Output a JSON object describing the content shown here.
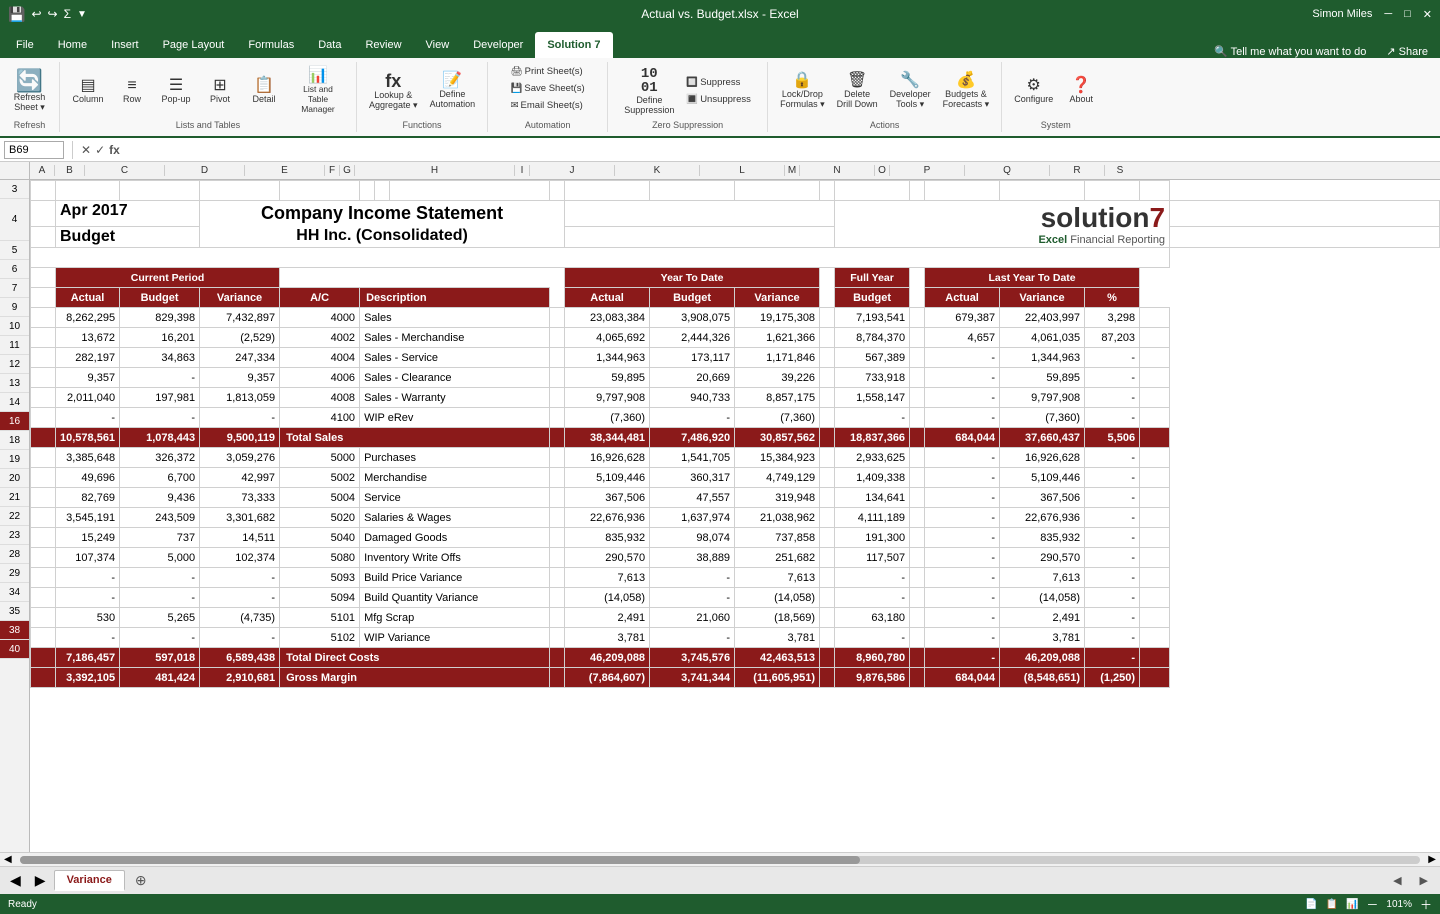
{
  "titleBar": {
    "title": "Actual vs. Budget.xlsx - Excel",
    "user": "Simon Miles"
  },
  "ribbon": {
    "tabs": [
      "File",
      "Home",
      "Insert",
      "Page Layout",
      "Formulas",
      "Data",
      "Review",
      "View",
      "Developer",
      "Solution 7"
    ],
    "activeTab": "Solution 7",
    "groups": {
      "refresh": {
        "label": "Refresh",
        "items": [
          {
            "icon": "🔄",
            "text": "Refresh\nSheet ▾"
          }
        ]
      },
      "listsAndTables": {
        "label": "Lists and Tables",
        "items": [
          {
            "icon": "▤",
            "text": "Column"
          },
          {
            "icon": "≡",
            "text": "Row"
          },
          {
            "icon": "☰",
            "text": "Pop-up"
          },
          {
            "icon": "⊞",
            "text": "Pivot"
          },
          {
            "icon": "📋",
            "text": "Detail"
          },
          {
            "icon": "📊",
            "text": "List and Table\nManager"
          }
        ]
      },
      "functions": {
        "label": "Functions",
        "items": [
          {
            "icon": "fx",
            "text": "Lookup &\nAggregate ▾"
          },
          {
            "icon": "📝",
            "text": "Define\nAutomation"
          }
        ]
      },
      "automation": {
        "label": "Automation",
        "items": [
          {
            "text": "🖨 Print Sheet(s)"
          },
          {
            "text": "💾 Save Sheet(s)"
          },
          {
            "text": "✉ Email Sheet(s)"
          }
        ]
      },
      "zeroSuppression": {
        "label": "Zero Suppression",
        "items": [
          {
            "icon": "10|01",
            "text": "Define\nSuppression"
          },
          {
            "text": "Suppress"
          },
          {
            "text": "Unsuppress"
          }
        ]
      },
      "actions": {
        "label": "Actions",
        "items": [
          {
            "icon": "🔒",
            "text": "Lock/Drop\nFormulas ▾"
          },
          {
            "icon": "🗑",
            "text": "Delete\nDrill Down"
          },
          {
            "icon": "🔧",
            "text": "Developer\nTools ▾"
          },
          {
            "icon": "💰",
            "text": "Budgets &\nForecasts ▾"
          }
        ]
      },
      "system": {
        "label": "System",
        "items": [
          {
            "icon": "⚙",
            "text": "Configure"
          },
          {
            "icon": "❓",
            "text": "About"
          }
        ]
      }
    }
  },
  "formulaBar": {
    "cellRef": "B69",
    "formula": ""
  },
  "spreadsheet": {
    "title1": "Company Income Statement",
    "title2": "HH Inc. (Consolidated)",
    "period": "Apr 2017",
    "periodType": "Budget",
    "logo": "solution7",
    "logoSub": "Excel Financial Reporting",
    "columnHeaders": [
      "B",
      "C",
      "D",
      "E",
      "F",
      "G",
      "H",
      "I",
      "J",
      "K",
      "L",
      "M",
      "N",
      "O",
      "P",
      "Q",
      "R",
      "S"
    ],
    "headers": {
      "currentPeriod": "Current Period",
      "actual": "Actual",
      "budget": "Budget",
      "variance": "Variance",
      "ac": "A/C",
      "description": "Description",
      "ytd": "Year To Date",
      "ytdActual": "Actual",
      "ytdBudget": "Budget",
      "ytdVariance": "Variance",
      "fullYear": "Full Year",
      "fullYearBudget": "Budget",
      "lastYearToDate": "Last Year To Date",
      "lytdActual": "Actual",
      "lytdVariance": "Variance",
      "pct": "%"
    },
    "rows": [
      {
        "rowNum": "9",
        "cpActual": "8,262,295",
        "cpBudget": "829,398",
        "cpVariance": "7,432,897",
        "ac": "4000",
        "desc": "Sales",
        "ytdActual": "23,083,384",
        "ytdBudget": "3,908,075",
        "ytdVariance": "19,175,308",
        "fyBudget": "7,193,541",
        "lytdActual": "679,387",
        "lytdVariance": "22,403,997",
        "pct": "3,298"
      },
      {
        "rowNum": "10",
        "cpActual": "13,672",
        "cpBudget": "16,201",
        "cpVariance": "(2,529)",
        "ac": "4002",
        "desc": "Sales - Merchandise",
        "ytdActual": "4,065,692",
        "ytdBudget": "2,444,326",
        "ytdVariance": "1,621,366",
        "fyBudget": "8,784,370",
        "lytdActual": "4,657",
        "lytdVariance": "4,061,035",
        "pct": "87,203"
      },
      {
        "rowNum": "11",
        "cpActual": "282,197",
        "cpBudget": "34,863",
        "cpVariance": "247,334",
        "ac": "4004",
        "desc": "Sales - Service",
        "ytdActual": "1,344,963",
        "ytdBudget": "173,117",
        "ytdVariance": "1,171,846",
        "fyBudget": "567,389",
        "lytdActual": "-",
        "lytdVariance": "1,344,963",
        "pct": "-"
      },
      {
        "rowNum": "12",
        "cpActual": "9,357",
        "cpBudget": "-",
        "cpVariance": "9,357",
        "ac": "4006",
        "desc": "Sales - Clearance",
        "ytdActual": "59,895",
        "ytdBudget": "20,669",
        "ytdVariance": "39,226",
        "fyBudget": "733,918",
        "lytdActual": "-",
        "lytdVariance": "59,895",
        "pct": "-"
      },
      {
        "rowNum": "13",
        "cpActual": "2,011,040",
        "cpBudget": "197,981",
        "cpVariance": "1,813,059",
        "ac": "4008",
        "desc": "Sales - Warranty",
        "ytdActual": "9,797,908",
        "ytdBudget": "940,733",
        "ytdVariance": "8,857,175",
        "fyBudget": "1,558,147",
        "lytdActual": "-",
        "lytdVariance": "9,797,908",
        "pct": "-"
      },
      {
        "rowNum": "14",
        "cpActual": "-",
        "cpBudget": "-",
        "cpVariance": "-",
        "ac": "4100",
        "desc": "WIP eRev",
        "ytdActual": "(7,360)",
        "ytdBudget": "-",
        "ytdVariance": "(7,360)",
        "fyBudget": "-",
        "lytdActual": "-",
        "lytdVariance": "(7,360)",
        "pct": "-"
      },
      {
        "rowNum": "16",
        "isTotalSales": true,
        "cpActual": "10,578,561",
        "cpBudget": "1,078,443",
        "cpVariance": "9,500,119",
        "desc": "Total Sales",
        "ytdActual": "38,344,481",
        "ytdBudget": "7,486,920",
        "ytdVariance": "30,857,562",
        "fyBudget": "18,837,366",
        "lytdActual": "684,044",
        "lytdVariance": "37,660,437",
        "pct": "5,506"
      },
      {
        "rowNum": "18",
        "cpActual": "3,385,648",
        "cpBudget": "326,372",
        "cpVariance": "3,059,276",
        "ac": "5000",
        "desc": "Purchases",
        "ytdActual": "16,926,628",
        "ytdBudget": "1,541,705",
        "ytdVariance": "15,384,923",
        "fyBudget": "2,933,625",
        "lytdActual": "-",
        "lytdVariance": "16,926,628",
        "pct": "-"
      },
      {
        "rowNum": "19",
        "cpActual": "49,696",
        "cpBudget": "6,700",
        "cpVariance": "42,997",
        "ac": "5002",
        "desc": "Merchandise",
        "ytdActual": "5,109,446",
        "ytdBudget": "360,317",
        "ytdVariance": "4,749,129",
        "fyBudget": "1,409,338",
        "lytdActual": "-",
        "lytdVariance": "5,109,446",
        "pct": "-"
      },
      {
        "rowNum": "20",
        "cpActual": "82,769",
        "cpBudget": "9,436",
        "cpVariance": "73,333",
        "ac": "5004",
        "desc": "Service",
        "ytdActual": "367,506",
        "ytdBudget": "47,557",
        "ytdVariance": "319,948",
        "fyBudget": "134,641",
        "lytdActual": "-",
        "lytdVariance": "367,506",
        "pct": "-"
      },
      {
        "rowNum": "21",
        "cpActual": "3,545,191",
        "cpBudget": "243,509",
        "cpVariance": "3,301,682",
        "ac": "5020",
        "desc": "Salaries & Wages",
        "ytdActual": "22,676,936",
        "ytdBudget": "1,637,974",
        "ytdVariance": "21,038,962",
        "fyBudget": "4,111,189",
        "lytdActual": "-",
        "lytdVariance": "22,676,936",
        "pct": "-"
      },
      {
        "rowNum": "22",
        "cpActual": "15,249",
        "cpBudget": "737",
        "cpVariance": "14,511",
        "ac": "5040",
        "desc": "Damaged Goods",
        "ytdActual": "835,932",
        "ytdBudget": "98,074",
        "ytdVariance": "737,858",
        "fyBudget": "191,300",
        "lytdActual": "-",
        "lytdVariance": "835,932",
        "pct": "-"
      },
      {
        "rowNum": "23",
        "cpActual": "107,374",
        "cpBudget": "5,000",
        "cpVariance": "102,374",
        "ac": "5080",
        "desc": "Inventory Write Offs",
        "ytdActual": "290,570",
        "ytdBudget": "38,889",
        "ytdVariance": "251,682",
        "fyBudget": "117,507",
        "lytdActual": "-",
        "lytdVariance": "290,570",
        "pct": "-"
      },
      {
        "rowNum": "28",
        "cpActual": "-",
        "cpBudget": "-",
        "cpVariance": "-",
        "ac": "5093",
        "desc": "Build Price Variance",
        "ytdActual": "7,613",
        "ytdBudget": "-",
        "ytdVariance": "7,613",
        "fyBudget": "-",
        "lytdActual": "-",
        "lytdVariance": "7,613",
        "pct": "-"
      },
      {
        "rowNum": "29",
        "cpActual": "-",
        "cpBudget": "-",
        "cpVariance": "-",
        "ac": "5094",
        "desc": "Build Quantity Variance",
        "ytdActual": "(14,058)",
        "ytdBudget": "-",
        "ytdVariance": "(14,058)",
        "fyBudget": "-",
        "lytdActual": "-",
        "lytdVariance": "(14,058)",
        "pct": "-"
      },
      {
        "rowNum": "34",
        "cpActual": "530",
        "cpBudget": "5,265",
        "cpVariance": "(4,735)",
        "ac": "5101",
        "desc": "Mfg Scrap",
        "ytdActual": "2,491",
        "ytdBudget": "21,060",
        "ytdVariance": "(18,569)",
        "fyBudget": "63,180",
        "lytdActual": "-",
        "lytdVariance": "2,491",
        "pct": "-"
      },
      {
        "rowNum": "35",
        "cpActual": "-",
        "cpBudget": "-",
        "cpVariance": "-",
        "ac": "5102",
        "desc": "WIP Variance",
        "ytdActual": "3,781",
        "ytdBudget": "-",
        "ytdVariance": "3,781",
        "fyBudget": "-",
        "lytdActual": "-",
        "lytdVariance": "3,781",
        "pct": "-"
      },
      {
        "rowNum": "38",
        "isTotalDirect": true,
        "cpActual": "7,186,457",
        "cpBudget": "597,018",
        "cpVariance": "6,589,438",
        "desc": "Total Direct Costs",
        "ytdActual": "46,209,088",
        "ytdBudget": "3,745,576",
        "ytdVariance": "42,463,513",
        "fyBudget": "8,960,780",
        "lytdActual": "-",
        "lytdVariance": "46,209,088",
        "pct": "-"
      },
      {
        "rowNum": "40",
        "isGrossMargin": true,
        "cpActual": "3,392,105",
        "cpBudget": "481,424",
        "cpVariance": "2,910,681",
        "desc": "Gross Margin",
        "ytdActual": "(7,864,607)",
        "ytdBudget": "3,741,344",
        "ytdVariance": "(11,605,951)",
        "fyBudget": "9,876,586",
        "lytdActual": "684,044",
        "lytdVariance": "(8,548,651)",
        "pct": "(1,250)"
      }
    ]
  },
  "sheetTabs": [
    "Variance"
  ],
  "statusBar": {
    "status": "Ready"
  }
}
